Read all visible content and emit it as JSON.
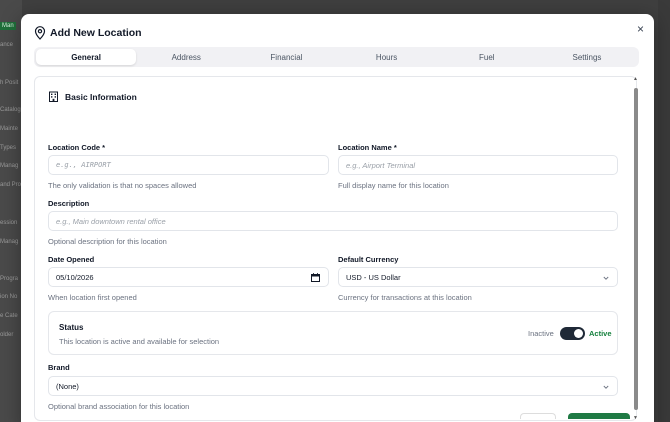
{
  "background": {
    "sidebar_items": [
      "Man",
      "ance",
      "h Posit",
      "Catalog",
      "Mainte",
      "Types",
      "Manag",
      "and Pro",
      "ession",
      "Manag",
      "Progra",
      "ion No",
      "e Cate",
      "older"
    ]
  },
  "modal": {
    "title": "Add New Location",
    "close_label": "×",
    "tabs": [
      {
        "label": "General",
        "active": true
      },
      {
        "label": "Address",
        "active": false
      },
      {
        "label": "Financial",
        "active": false
      },
      {
        "label": "Hours",
        "active": false
      },
      {
        "label": "Fuel",
        "active": false
      },
      {
        "label": "Settings",
        "active": false
      }
    ]
  },
  "form": {
    "section_title": "Basic Information",
    "location_code": {
      "label": "Location Code *",
      "placeholder": "e.g., AIRPORT",
      "help": "The only validation is that no spaces allowed"
    },
    "location_name": {
      "label": "Location Name *",
      "placeholder": "e.g., Airport Terminal",
      "help": "Full display name for this location"
    },
    "description": {
      "label": "Description",
      "placeholder": "e.g., Main downtown rental office",
      "help": "Optional description for this location"
    },
    "date_opened": {
      "label": "Date Opened",
      "value": "05/10/2026",
      "help": "When location first opened"
    },
    "default_currency": {
      "label": "Default Currency",
      "value": "USD - US Dollar",
      "help": "Currency for transactions at this location"
    },
    "status": {
      "title": "Status",
      "description": "This location is active and available for selection",
      "off_label": "Inactive",
      "on_label": "Active",
      "is_active": true
    },
    "brand": {
      "label": "Brand",
      "value": "(None)",
      "help": "Optional brand association for this location"
    }
  },
  "colors": {
    "accent_green": "#15803d",
    "toggle_track": "#1f2937",
    "sidebar_active": "#1f6f3a"
  }
}
